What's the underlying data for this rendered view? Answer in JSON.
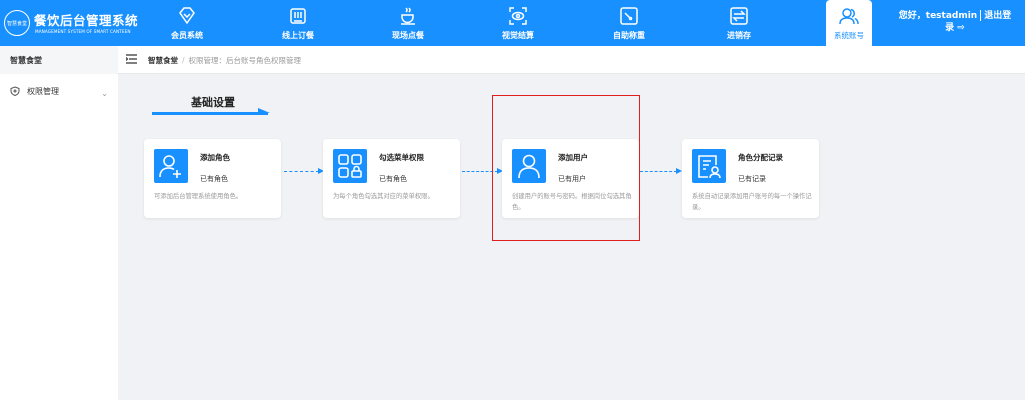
{
  "app": {
    "logo_badge": "智慧食堂",
    "title": "餐饮后台管理系统",
    "subtitle": "MANAGEMENT SYSTEM OF SMART CANTEEN"
  },
  "nav": [
    {
      "label": "会员系统",
      "icon": "diamond-icon"
    },
    {
      "label": "线上订餐",
      "icon": "order-icon"
    },
    {
      "label": "现场点餐",
      "icon": "coffee-cup-icon"
    },
    {
      "label": "视觉结算",
      "icon": "scan-eye-icon"
    },
    {
      "label": "自助称重",
      "icon": "scale-icon"
    },
    {
      "label": "进销存",
      "icon": "inventory-icon"
    },
    {
      "label": "系统账号",
      "icon": "users-icon",
      "active": true
    }
  ],
  "user": {
    "greeting": "您好，testadmin",
    "logout_1": "退出登",
    "logout_2": "录"
  },
  "sidebar": {
    "header": "智慧食堂",
    "items": [
      {
        "label": "权限管理",
        "icon": "shield-icon"
      }
    ]
  },
  "breadcrumb": {
    "root": "智慧食堂",
    "separator": "/",
    "current": "权限管理：后台账号角色权限管理"
  },
  "section": {
    "title": "基础设置"
  },
  "cards": [
    {
      "title": "添加角色",
      "status": "已有角色",
      "desc": "可添加后台管理系统使用角色。",
      "icon": "add-user-icon"
    },
    {
      "title": "勾选菜单权限",
      "status": "已有角色",
      "desc": "为每个角色勾选其对应的菜单权限。",
      "icon": "grid-lock-icon"
    },
    {
      "title": "添加用户",
      "status": "已有用户",
      "desc": "创建用户的账号与密码。根据岗位勾选其角色。",
      "icon": "user-icon"
    },
    {
      "title": "角色分配记录",
      "status": "已有记录",
      "desc": "系统自动记录添加用户账号的每一个操作记录。",
      "icon": "record-icon"
    }
  ],
  "colors": {
    "primary": "#1890ff",
    "highlight": "#e02020",
    "background": "#f0f2f5"
  }
}
